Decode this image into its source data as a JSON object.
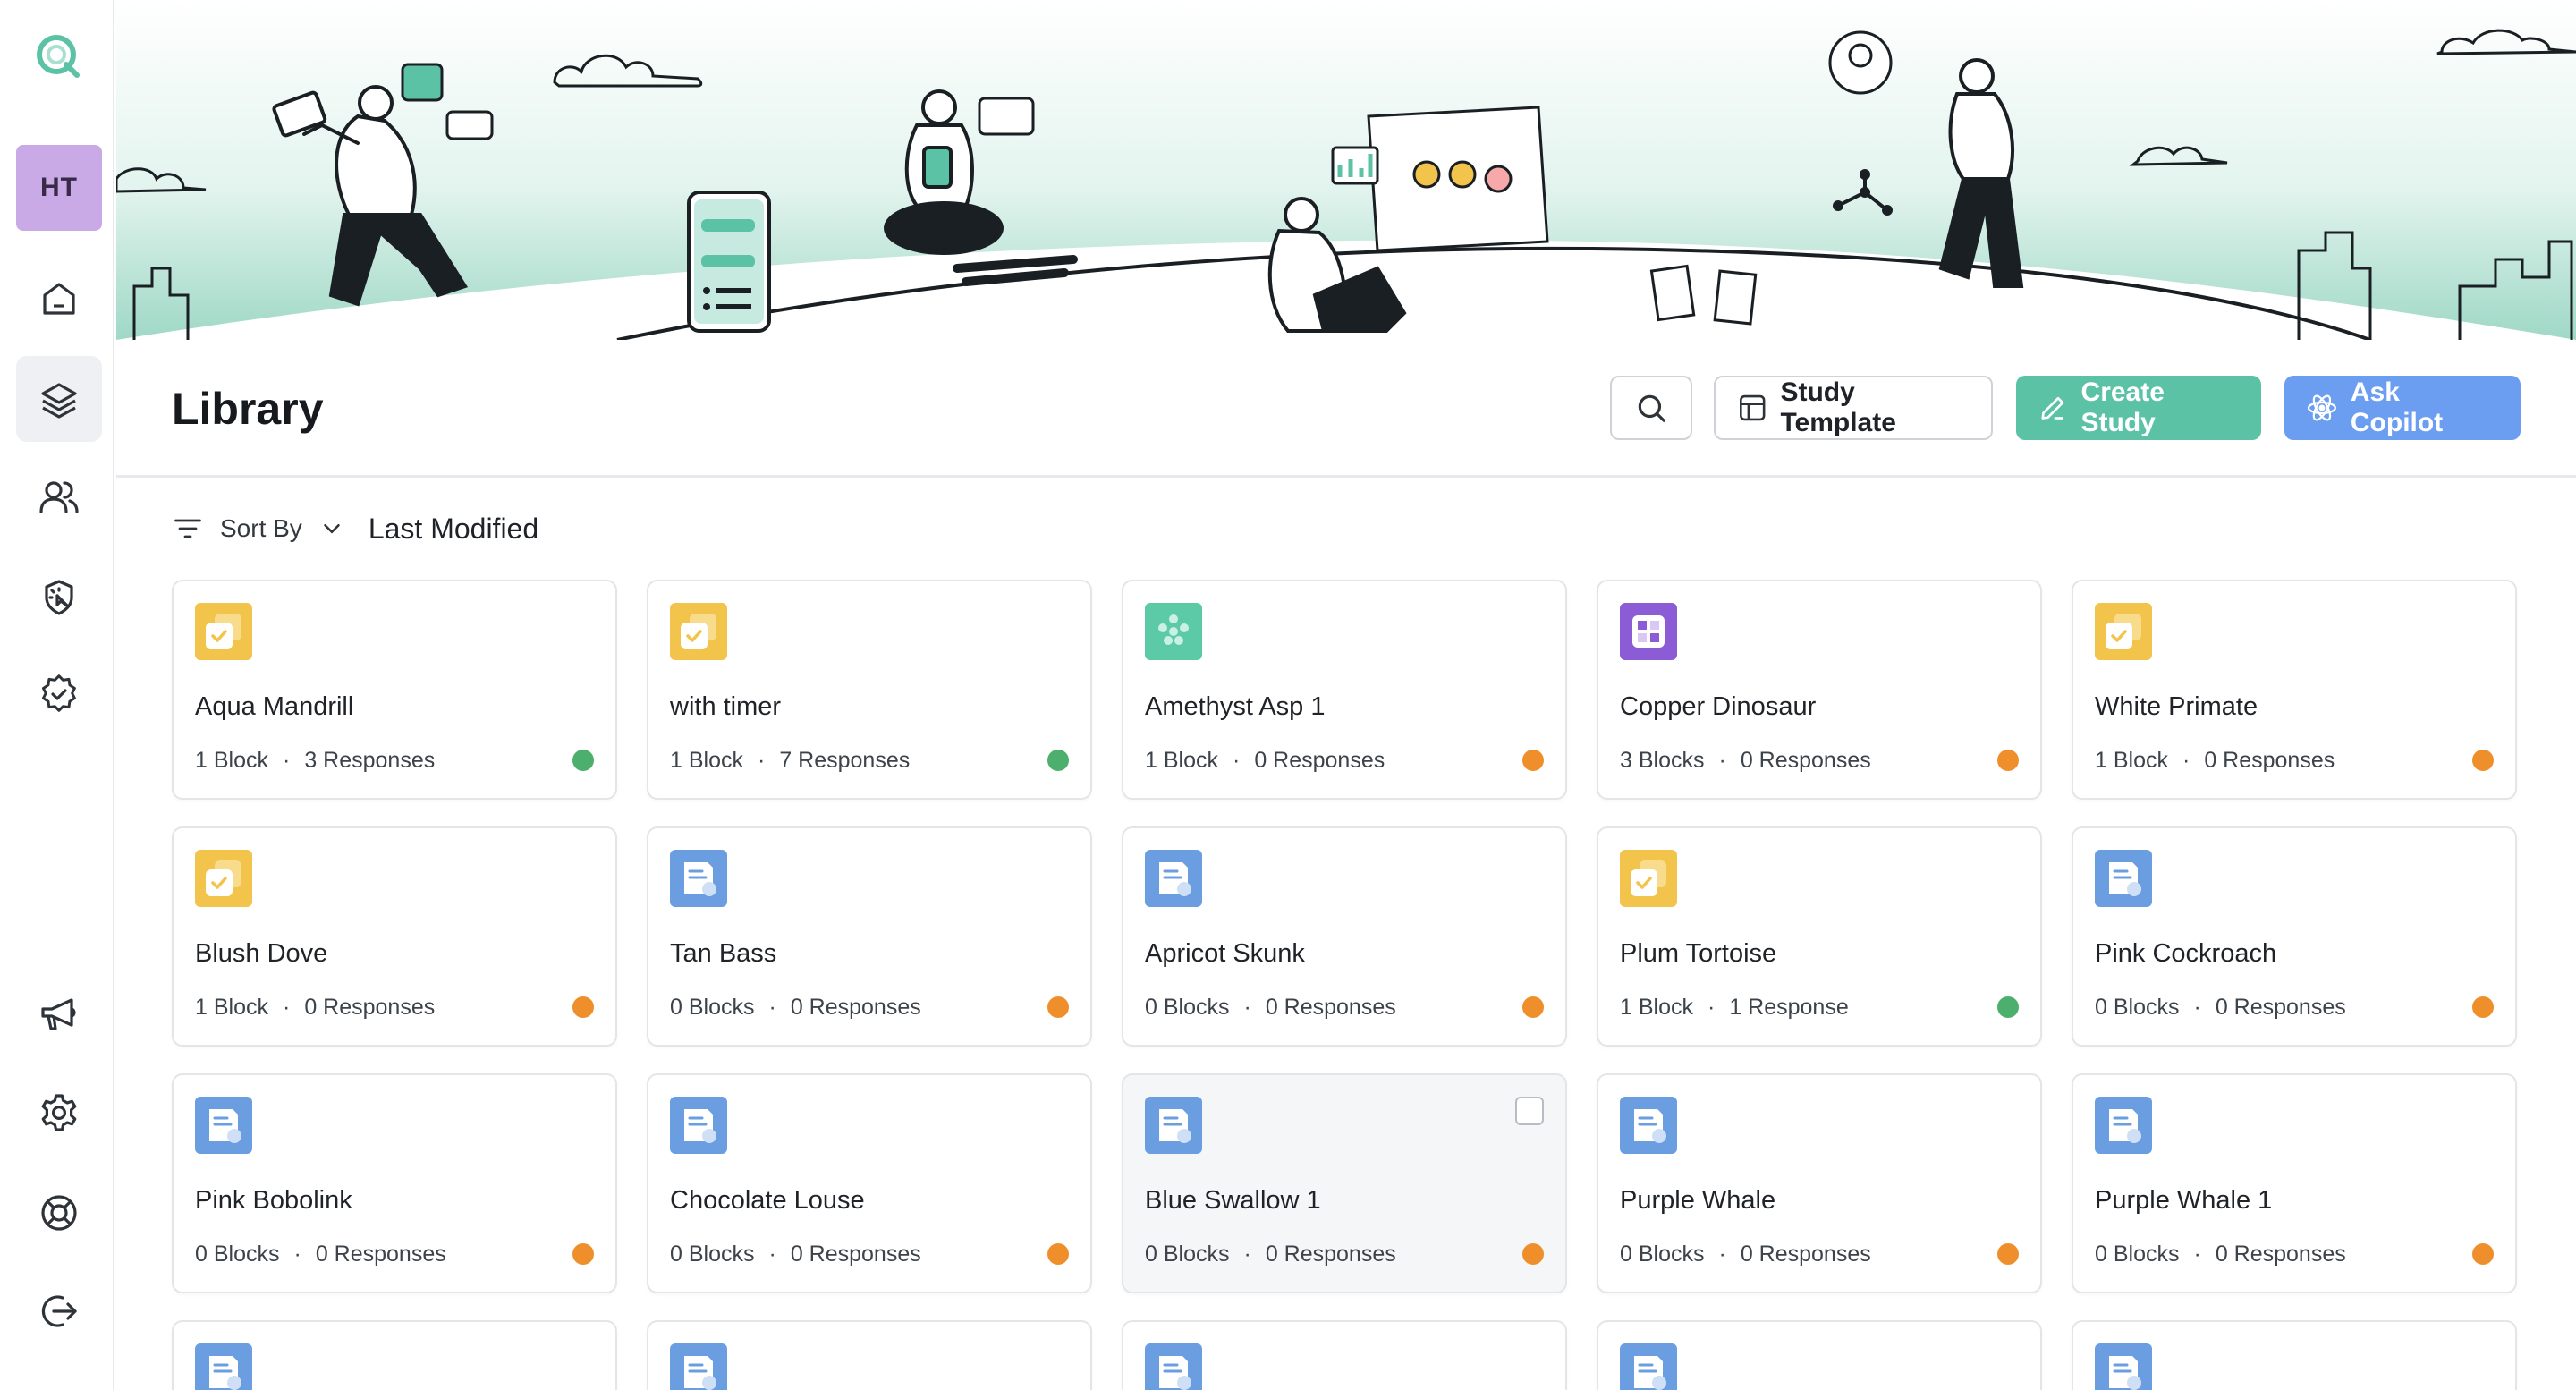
{
  "sidebar": {
    "avatar_initials": "HT",
    "nav": [
      {
        "name": "home",
        "icon": "home-icon"
      },
      {
        "name": "library",
        "icon": "layers-icon",
        "active": true
      },
      {
        "name": "users",
        "icon": "users-icon"
      },
      {
        "name": "click-test",
        "icon": "cursor-click-icon"
      },
      {
        "name": "verified",
        "icon": "badge-check-icon"
      }
    ],
    "bottom_nav": [
      {
        "name": "announcements",
        "icon": "megaphone-icon"
      },
      {
        "name": "settings",
        "icon": "gear-icon"
      },
      {
        "name": "help",
        "icon": "lifebuoy-icon"
      },
      {
        "name": "logout",
        "icon": "logout-icon"
      }
    ]
  },
  "header": {
    "title": "Library",
    "study_template_label": "Study Template",
    "create_study_label": "Create Study",
    "ask_copilot_label": "Ask Copilot"
  },
  "sort": {
    "label": "Sort By",
    "value": "Last Modified"
  },
  "colors": {
    "create": "#5cc2a5",
    "copilot": "#6b9ef0",
    "status_green": "#4caf6d",
    "status_orange": "#ef8f2b",
    "icon_yellow": "#f3c44c",
    "icon_blue": "#6a9ee0",
    "icon_teal": "#5cc9a7",
    "icon_purple": "#8b5cd6"
  },
  "cards": [
    {
      "title": "Aqua Mandrill",
      "blocks": "1 Block",
      "responses": "3 Responses",
      "status": "green",
      "icon": "yellow-check"
    },
    {
      "title": "with timer",
      "blocks": "1 Block",
      "responses": "7 Responses",
      "status": "green",
      "icon": "yellow-check"
    },
    {
      "title": "Amethyst Asp 1",
      "blocks": "1 Block",
      "responses": "0 Responses",
      "status": "orange",
      "icon": "teal-dots"
    },
    {
      "title": "Copper Dinosaur",
      "blocks": "3 Blocks",
      "responses": "0 Responses",
      "status": "orange",
      "icon": "purple-grid"
    },
    {
      "title": "White Primate",
      "blocks": "1 Block",
      "responses": "0 Responses",
      "status": "orange",
      "icon": "yellow-check"
    },
    {
      "title": "Blush Dove",
      "blocks": "1 Block",
      "responses": "0 Responses",
      "status": "orange",
      "icon": "yellow-check"
    },
    {
      "title": "Tan Bass",
      "blocks": "0 Blocks",
      "responses": "0 Responses",
      "status": "orange",
      "icon": "blue-doc"
    },
    {
      "title": "Apricot Skunk",
      "blocks": "0 Blocks",
      "responses": "0 Responses",
      "status": "orange",
      "icon": "blue-doc"
    },
    {
      "title": "Plum Tortoise",
      "blocks": "1 Block",
      "responses": "1 Response",
      "status": "green",
      "icon": "yellow-check"
    },
    {
      "title": "Pink Cockroach",
      "blocks": "0 Blocks",
      "responses": "0 Responses",
      "status": "orange",
      "icon": "blue-doc"
    },
    {
      "title": "Pink Bobolink",
      "blocks": "0 Blocks",
      "responses": "0 Responses",
      "status": "orange",
      "icon": "blue-doc"
    },
    {
      "title": "Chocolate Louse",
      "blocks": "0 Blocks",
      "responses": "0 Responses",
      "status": "orange",
      "icon": "blue-doc"
    },
    {
      "title": "Blue Swallow 1",
      "blocks": "0 Blocks",
      "responses": "0 Responses",
      "status": "orange",
      "icon": "blue-doc",
      "hovered": true
    },
    {
      "title": "Purple Whale",
      "blocks": "0 Blocks",
      "responses": "0 Responses",
      "status": "orange",
      "icon": "blue-doc"
    },
    {
      "title": "Purple Whale 1",
      "blocks": "0 Blocks",
      "responses": "0 Responses",
      "status": "orange",
      "icon": "blue-doc"
    }
  ],
  "partial_cards": [
    {
      "icon": "blue-doc"
    },
    {
      "icon": "blue-doc"
    },
    {
      "icon": "blue-doc"
    },
    {
      "icon": "blue-doc"
    },
    {
      "icon": "blue-doc"
    }
  ]
}
